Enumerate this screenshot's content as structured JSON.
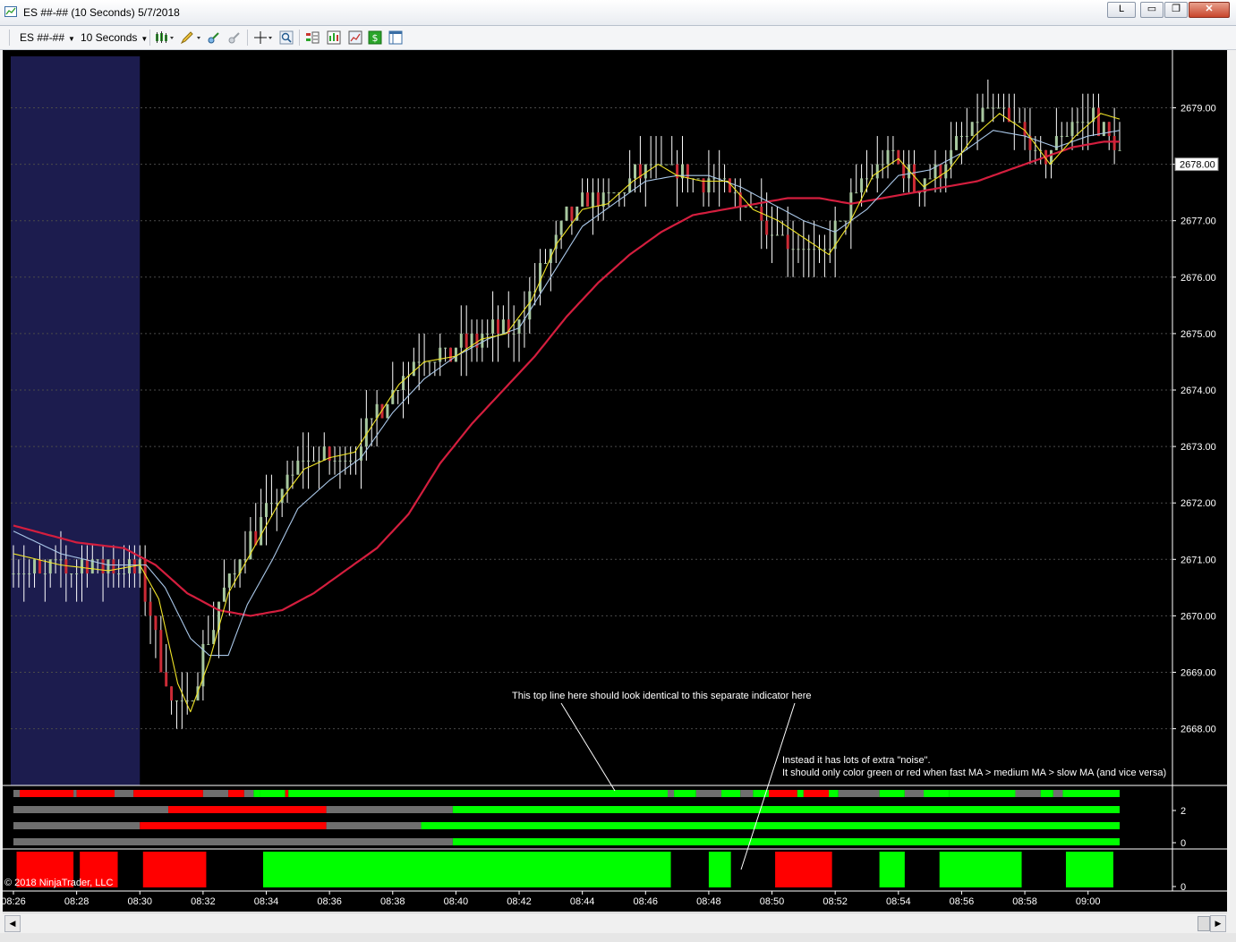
{
  "window": {
    "title": "ES ##-## (10 Seconds)  5/7/2018",
    "buttons": {
      "l": "L",
      "minimize": "▭",
      "restore": "❐",
      "close": "✕"
    }
  },
  "toolbar": {
    "instrument": "ES ##-##",
    "interval": "10 Seconds"
  },
  "icons": [
    "chart-style-icon",
    "pencil-icon",
    "crosshair-icon",
    "zoom-icon",
    "data-box-icon",
    "properties-icon"
  ],
  "colors": {
    "background": "#000000",
    "session_shade": "#1c1c4e",
    "up_candle": "#a8c8a0",
    "down_candle": "#cc2b36",
    "fast_ma": "#f0e428",
    "medium_ma": "#a9c7e8",
    "slow_ma": "#d41e3e",
    "green": "#00ff00",
    "red": "#ff0000",
    "neutral": "#6f6f6f",
    "grid": "#4a4a4a"
  },
  "chart_data": {
    "type": "candlestick",
    "x_ticks": [
      "08:26",
      "08:28",
      "08:30",
      "08:32",
      "08:34",
      "08:36",
      "08:38",
      "08:40",
      "08:42",
      "08:44",
      "08:46",
      "08:48",
      "08:50",
      "08:52",
      "08:54",
      "08:56",
      "08:58",
      "09:00"
    ],
    "y_ticks": [
      "2679.00",
      "2678.00",
      "2677.00",
      "2676.00",
      "2675.00",
      "2674.00",
      "2673.00",
      "2672.00",
      "2671.00",
      "2670.00",
      "2669.00",
      "2668.00"
    ],
    "ylim": [
      2667.0,
      2680.0
    ],
    "time_range_minutes": [
      0,
      35
    ],
    "last_price": "2678.00",
    "session_shade_end_minute": 4.0,
    "close_anchors": [
      [
        0.0,
        2670.8
      ],
      [
        1.0,
        2670.8
      ],
      [
        2.0,
        2670.9
      ],
      [
        3.0,
        2670.9
      ],
      [
        4.0,
        2670.8
      ],
      [
        4.4,
        2669.8
      ],
      [
        5.0,
        2668.4
      ],
      [
        5.5,
        2668.3
      ],
      [
        6.0,
        2669.4
      ],
      [
        6.6,
        2670.3
      ],
      [
        7.2,
        2671.1
      ],
      [
        7.8,
        2671.6
      ],
      [
        8.5,
        2672.2
      ],
      [
        9.2,
        2672.8
      ],
      [
        10.0,
        2672.7
      ],
      [
        10.8,
        2672.9
      ],
      [
        11.5,
        2673.6
      ],
      [
        12.2,
        2674.2
      ],
      [
        13.0,
        2674.6
      ],
      [
        13.8,
        2674.6
      ],
      [
        14.5,
        2674.9
      ],
      [
        15.2,
        2675.0
      ],
      [
        15.8,
        2675.0
      ],
      [
        16.5,
        2675.8
      ],
      [
        17.2,
        2676.8
      ],
      [
        18.0,
        2677.3
      ],
      [
        18.8,
        2677.3
      ],
      [
        19.6,
        2677.7
      ],
      [
        20.2,
        2678.0
      ],
      [
        20.8,
        2677.8
      ],
      [
        21.6,
        2677.7
      ],
      [
        22.2,
        2677.8
      ],
      [
        22.8,
        2677.4
      ],
      [
        23.4,
        2677.2
      ],
      [
        24.0,
        2676.9
      ],
      [
        24.8,
        2676.6
      ],
      [
        25.6,
        2676.4
      ],
      [
        26.3,
        2677.1
      ],
      [
        27.0,
        2677.8
      ],
      [
        27.8,
        2678.2
      ],
      [
        28.6,
        2677.6
      ],
      [
        29.4,
        2677.9
      ],
      [
        30.2,
        2678.6
      ],
      [
        31.0,
        2679.0
      ],
      [
        31.8,
        2678.6
      ],
      [
        32.6,
        2678.0
      ],
      [
        33.4,
        2678.7
      ],
      [
        34.2,
        2678.9
      ],
      [
        35.0,
        2678.1
      ]
    ],
    "ma_anchors": {
      "fast": [
        [
          0.0,
          2671.1
        ],
        [
          1.5,
          2670.9
        ],
        [
          3.0,
          2670.8
        ],
        [
          4.0,
          2670.9
        ],
        [
          4.6,
          2670.3
        ],
        [
          5.2,
          2668.8
        ],
        [
          5.6,
          2668.3
        ],
        [
          6.2,
          2669.2
        ],
        [
          6.8,
          2670.4
        ],
        [
          7.6,
          2671.2
        ],
        [
          8.4,
          2672.0
        ],
        [
          9.2,
          2672.6
        ],
        [
          10.0,
          2672.8
        ],
        [
          10.8,
          2672.9
        ],
        [
          11.5,
          2673.5
        ],
        [
          12.2,
          2674.1
        ],
        [
          13.0,
          2674.5
        ],
        [
          14.0,
          2674.6
        ],
        [
          14.8,
          2674.9
        ],
        [
          15.6,
          2675.0
        ],
        [
          16.4,
          2675.6
        ],
        [
          17.2,
          2676.6
        ],
        [
          18.0,
          2677.2
        ],
        [
          18.8,
          2677.3
        ],
        [
          19.6,
          2677.7
        ],
        [
          20.4,
          2678.0
        ],
        [
          21.0,
          2677.8
        ],
        [
          21.8,
          2677.7
        ],
        [
          22.6,
          2677.7
        ],
        [
          23.4,
          2677.2
        ],
        [
          24.2,
          2677.0
        ],
        [
          25.0,
          2676.7
        ],
        [
          25.8,
          2676.4
        ],
        [
          26.4,
          2676.9
        ],
        [
          27.2,
          2677.8
        ],
        [
          28.0,
          2678.1
        ],
        [
          28.8,
          2677.6
        ],
        [
          29.6,
          2677.9
        ],
        [
          30.4,
          2678.5
        ],
        [
          31.2,
          2678.9
        ],
        [
          32.0,
          2678.6
        ],
        [
          32.8,
          2678.0
        ],
        [
          33.6,
          2678.5
        ],
        [
          34.4,
          2678.9
        ],
        [
          35.0,
          2678.8
        ]
      ],
      "medium": [
        [
          0.0,
          2671.5
        ],
        [
          1.5,
          2671.1
        ],
        [
          3.0,
          2670.9
        ],
        [
          4.2,
          2670.9
        ],
        [
          4.8,
          2670.5
        ],
        [
          5.6,
          2669.6
        ],
        [
          6.2,
          2669.3
        ],
        [
          6.8,
          2669.3
        ],
        [
          7.4,
          2670.2
        ],
        [
          8.2,
          2671.0
        ],
        [
          9.0,
          2671.9
        ],
        [
          10.0,
          2672.4
        ],
        [
          11.0,
          2672.8
        ],
        [
          12.0,
          2673.6
        ],
        [
          13.0,
          2674.2
        ],
        [
          14.0,
          2674.6
        ],
        [
          15.0,
          2674.9
        ],
        [
          16.0,
          2675.1
        ],
        [
          17.0,
          2676.0
        ],
        [
          18.0,
          2676.9
        ],
        [
          19.0,
          2677.3
        ],
        [
          20.0,
          2677.7
        ],
        [
          21.0,
          2677.8
        ],
        [
          22.0,
          2677.8
        ],
        [
          23.0,
          2677.6
        ],
        [
          24.0,
          2677.3
        ],
        [
          25.0,
          2677.0
        ],
        [
          26.0,
          2676.8
        ],
        [
          27.0,
          2677.2
        ],
        [
          28.0,
          2677.8
        ],
        [
          29.0,
          2677.9
        ],
        [
          30.0,
          2678.2
        ],
        [
          31.0,
          2678.6
        ],
        [
          32.0,
          2678.5
        ],
        [
          33.0,
          2678.3
        ],
        [
          34.0,
          2678.5
        ],
        [
          35.0,
          2678.6
        ]
      ],
      "slow": [
        [
          0.0,
          2671.6
        ],
        [
          2.0,
          2671.3
        ],
        [
          3.5,
          2671.2
        ],
        [
          4.5,
          2670.9
        ],
        [
          5.5,
          2670.4
        ],
        [
          6.5,
          2670.1
        ],
        [
          7.5,
          2670.0
        ],
        [
          8.5,
          2670.1
        ],
        [
          9.5,
          2670.4
        ],
        [
          10.5,
          2670.8
        ],
        [
          11.5,
          2671.2
        ],
        [
          12.5,
          2671.8
        ],
        [
          13.5,
          2672.7
        ],
        [
          14.5,
          2673.4
        ],
        [
          15.5,
          2674.0
        ],
        [
          16.5,
          2674.6
        ],
        [
          17.5,
          2675.3
        ],
        [
          18.5,
          2675.9
        ],
        [
          19.5,
          2676.4
        ],
        [
          20.5,
          2676.8
        ],
        [
          21.5,
          2677.1
        ],
        [
          22.5,
          2677.2
        ],
        [
          23.5,
          2677.3
        ],
        [
          24.5,
          2677.4
        ],
        [
          25.5,
          2677.4
        ],
        [
          26.5,
          2677.3
        ],
        [
          27.5,
          2677.4
        ],
        [
          28.5,
          2677.5
        ],
        [
          29.5,
          2677.6
        ],
        [
          30.5,
          2677.7
        ],
        [
          31.5,
          2677.9
        ],
        [
          32.5,
          2678.1
        ],
        [
          33.5,
          2678.3
        ],
        [
          34.5,
          2678.4
        ],
        [
          35.0,
          2678.4
        ]
      ]
    },
    "indicator_rows": [
      {
        "segments": [
          [
            0.0,
            0.2,
            "n"
          ],
          [
            0.2,
            1.9,
            "r"
          ],
          [
            1.9,
            2.0,
            "n"
          ],
          [
            2.0,
            3.2,
            "r"
          ],
          [
            3.2,
            3.8,
            "n"
          ],
          [
            3.8,
            6.0,
            "r"
          ],
          [
            6.0,
            6.8,
            "n"
          ],
          [
            6.8,
            7.3,
            "r"
          ],
          [
            7.3,
            7.6,
            "n"
          ],
          [
            7.6,
            7.8,
            "g"
          ],
          [
            7.8,
            8.6,
            "g"
          ],
          [
            8.6,
            8.7,
            "r"
          ],
          [
            8.7,
            20.7,
            "g"
          ],
          [
            20.7,
            20.9,
            "n"
          ],
          [
            20.9,
            21.6,
            "g"
          ],
          [
            21.6,
            22.4,
            "n"
          ],
          [
            22.4,
            23.0,
            "g"
          ],
          [
            23.0,
            23.4,
            "n"
          ],
          [
            23.4,
            23.9,
            "g"
          ],
          [
            23.9,
            24.8,
            "r"
          ],
          [
            24.8,
            25.0,
            "g"
          ],
          [
            25.0,
            25.8,
            "r"
          ],
          [
            25.8,
            26.1,
            "g"
          ],
          [
            26.1,
            27.4,
            "n"
          ],
          [
            27.4,
            28.2,
            "g"
          ],
          [
            28.2,
            28.8,
            "n"
          ],
          [
            28.8,
            29.6,
            "g"
          ],
          [
            29.6,
            31.7,
            "g"
          ],
          [
            31.7,
            32.5,
            "n"
          ],
          [
            32.5,
            32.9,
            "g"
          ],
          [
            32.9,
            33.2,
            "n"
          ],
          [
            33.2,
            35.0,
            "g"
          ]
        ]
      },
      {
        "segments": [
          [
            0.0,
            4.9,
            "n"
          ],
          [
            4.9,
            9.9,
            "r"
          ],
          [
            9.9,
            13.9,
            "n"
          ],
          [
            13.9,
            35.0,
            "g"
          ]
        ]
      },
      {
        "segments": [
          [
            0.0,
            4.0,
            "n"
          ],
          [
            4.0,
            9.9,
            "r"
          ],
          [
            9.9,
            12.9,
            "n"
          ],
          [
            12.9,
            35.0,
            "g"
          ]
        ]
      },
      {
        "segments": [
          [
            0.0,
            13.9,
            "n"
          ],
          [
            13.9,
            35.0,
            "g"
          ]
        ]
      }
    ],
    "indicator_axis": [
      "2",
      "0"
    ],
    "separate_indicator": {
      "segments": [
        [
          0.1,
          1.9,
          "r"
        ],
        [
          2.1,
          3.3,
          "r"
        ],
        [
          4.1,
          6.1,
          "r"
        ],
        [
          7.9,
          20.8,
          "g"
        ],
        [
          22.0,
          22.7,
          "g"
        ],
        [
          24.1,
          25.9,
          "r"
        ],
        [
          27.4,
          28.2,
          "g"
        ],
        [
          29.3,
          31.9,
          "g"
        ],
        [
          33.3,
          34.8,
          "g"
        ]
      ],
      "axis": [
        "0"
      ]
    },
    "annotations": {
      "top": "This top line here should look identical to this separate indicator here",
      "noise_line1": "Instead it has lots of extra \"noise\".",
      "noise_line2": "It should only color green or red when fast MA > medium MA > slow MA (and vice versa)"
    },
    "copyright": "© 2018 NinjaTrader, LLC"
  }
}
